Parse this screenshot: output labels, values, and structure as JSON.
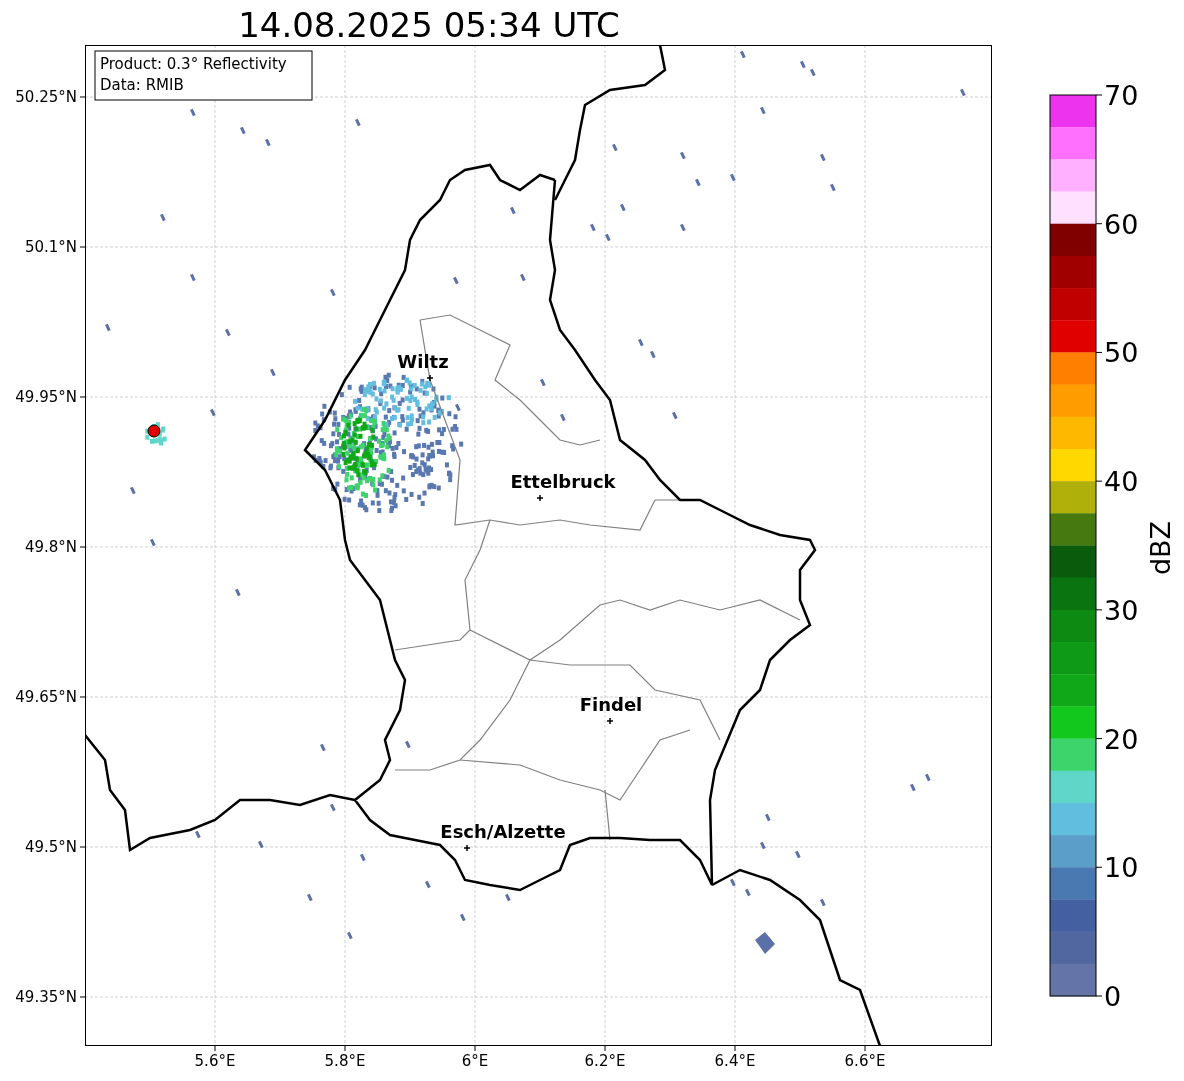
{
  "title": "14.08.2025 05:34 UTC",
  "info_box": {
    "lines": [
      "Product: 0.3° Reflectivity",
      "Data: RMIB"
    ]
  },
  "map": {
    "xticks": [
      "5.6°E",
      "5.8°E",
      "6°E",
      "6.2°E",
      "6.4°E",
      "6.6°E"
    ],
    "yticks": [
      "50.25°N",
      "50.1°N",
      "49.95°N",
      "49.8°N",
      "49.65°N",
      "49.5°N",
      "49.35°N"
    ],
    "cities": [
      {
        "name": "Wiltz"
      },
      {
        "name": "Ettelbruck"
      },
      {
        "name": "Findel"
      },
      {
        "name": "Esch/Alzette"
      }
    ]
  },
  "colorbar": {
    "label": "dBZ",
    "ticks": [
      "70",
      "60",
      "50",
      "40",
      "30",
      "20",
      "10",
      "0"
    ],
    "bins": [
      {
        "color": "#ee33ee"
      },
      {
        "color": "#ff70ff"
      },
      {
        "color": "#ffb0ff"
      },
      {
        "color": "#ffe0ff"
      },
      {
        "color": "#800000"
      },
      {
        "color": "#a00000"
      },
      {
        "color": "#c00000"
      },
      {
        "color": "#e00000"
      },
      {
        "color": "#ff8000"
      },
      {
        "color": "#ff9c00"
      },
      {
        "color": "#ffb800"
      },
      {
        "color": "#ffd800"
      },
      {
        "color": "#b0b00a"
      },
      {
        "color": "#467a10"
      },
      {
        "color": "#0a5c0c"
      },
      {
        "color": "#0a7410"
      },
      {
        "color": "#0c8a12"
      },
      {
        "color": "#0e9a16"
      },
      {
        "color": "#10a818"
      },
      {
        "color": "#12c81c"
      },
      {
        "color": "#3dd46c"
      },
      {
        "color": "#5fd6c8"
      },
      {
        "color": "#62bede"
      },
      {
        "color": "#5a9ec9"
      },
      {
        "color": "#4a78b0"
      },
      {
        "color": "#4460a0"
      },
      {
        "color": "#51679f"
      },
      {
        "color": "#6474a6"
      }
    ]
  }
}
